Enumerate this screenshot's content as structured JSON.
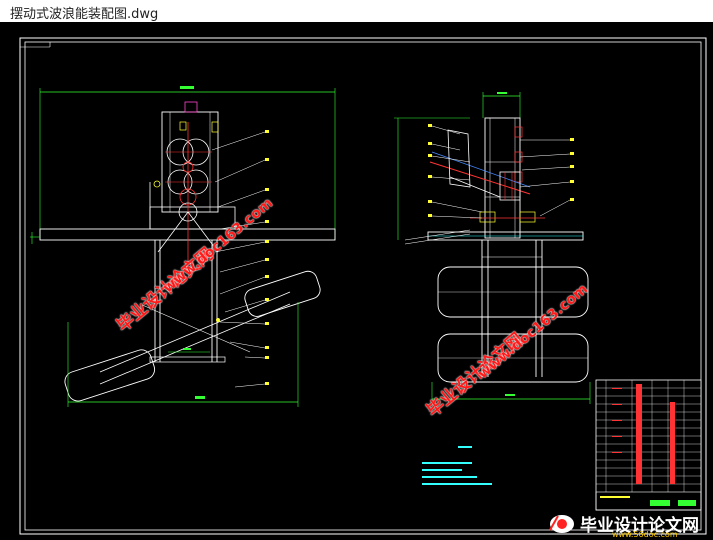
{
  "window": {
    "title": "摆动式波浪能装配图.dwg"
  },
  "watermarks": {
    "left_cn": "毕业设计论文网",
    "left_url": "www.doc163.com",
    "right_cn": "毕业设计论文网",
    "right_url": "www.doc163.com"
  },
  "logo": {
    "text": "毕业设计论文网",
    "url": "www.56doc.com"
  },
  "colors": {
    "background": "#000000",
    "line_white": "#ffffff",
    "line_green": "#33ff33",
    "line_yellow": "#ffff33",
    "line_red": "#ff3333",
    "line_magenta": "#ff44cc",
    "line_blue": "#4488ff",
    "line_cyan": "#33ffff"
  }
}
